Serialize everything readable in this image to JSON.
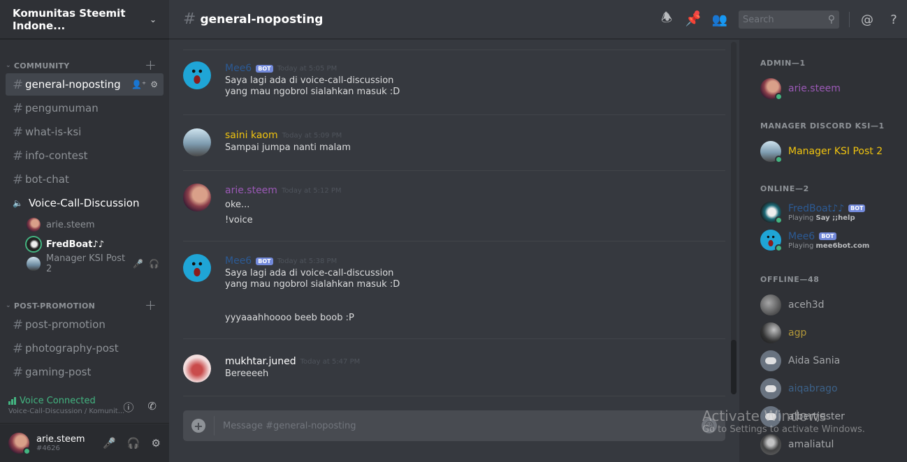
{
  "server": {
    "name": "Komunitas Steemit Indone...",
    "chevron_icon": "chevron-down-icon"
  },
  "categories": {
    "community": {
      "label": "COMMUNITY"
    },
    "post_promotion": {
      "label": "POST-PROMOTION"
    }
  },
  "channels": {
    "community": [
      {
        "name": "general-noposting",
        "active": true
      },
      {
        "name": "pengumuman"
      },
      {
        "name": "what-is-ksi"
      },
      {
        "name": "info-contest"
      },
      {
        "name": "bot-chat"
      }
    ],
    "voice": {
      "name": "Voice-Call-Discussion",
      "users": [
        {
          "name": "arie.steem"
        },
        {
          "name": "FredBoat♪♪",
          "speaking": true
        },
        {
          "name": "Manager KSI Post 2",
          "muted": true,
          "deafened": true
        }
      ]
    },
    "post_promotion": [
      {
        "name": "post-promotion"
      },
      {
        "name": "photography-post"
      },
      {
        "name": "gaming-post"
      }
    ]
  },
  "voice_panel": {
    "status": "Voice Connected",
    "location": "Voice-Call-Discussion / Komunit...",
    "status_color": "#43b581"
  },
  "user_panel": {
    "username": "arie.steem",
    "tag": "#4626"
  },
  "header": {
    "channel": "general-noposting",
    "search_placeholder": "Search"
  },
  "messages": [
    {
      "author": "Mee6",
      "bot": true,
      "bot_label": "BOT",
      "color": "#2c5a94",
      "timestamp": "Today at 5:05 PM",
      "lines": [
        "Saya lagi ada di voice-call-discussion",
        "yang mau ngobrol sialahkan masuk :D"
      ]
    },
    {
      "author": "saini kaom",
      "color": "#f1c40f",
      "timestamp": "Today at 5:09 PM",
      "lines": [
        "Sampai jumpa nanti malam"
      ]
    },
    {
      "author": "arie.steem",
      "color": "#9b59b6",
      "timestamp": "Today at 5:12 PM",
      "lines": [
        "oke...",
        "!voice"
      ]
    },
    {
      "author": "Mee6",
      "bot": true,
      "bot_label": "BOT",
      "color": "#2c5a94",
      "timestamp": "Today at 5:38 PM",
      "lines": [
        "Saya lagi ada di voice-call-discussion",
        "yang mau ngobrol sialahkan masuk :D"
      ],
      "extra": "yyyaaahhoooo beeb boob :P"
    },
    {
      "author": "mukhtar.juned",
      "color": "#ffffff",
      "timestamp": "Today at 5:47 PM",
      "lines": [
        "Bereeeeh"
      ]
    }
  ],
  "composer": {
    "placeholder": "Message #general-noposting"
  },
  "members": {
    "groups": [
      {
        "label": "ADMIN—1",
        "members": [
          {
            "name": "arie.steem",
            "color": "#9b59b6"
          }
        ]
      },
      {
        "label": "MANAGER DISCORD KSI—1",
        "members": [
          {
            "name": "Manager KSI Post 2",
            "color": "#f1c40f"
          }
        ]
      },
      {
        "label": "ONLINE—2",
        "members": [
          {
            "name": "FredBoat♪♪",
            "color": "#2c5a94",
            "bot": "BOT",
            "activity_prefix": "Playing ",
            "activity": "Say ;;help"
          },
          {
            "name": "Mee6",
            "color": "#2c5a94",
            "bot": "BOT",
            "activity_prefix": "Playing ",
            "activity": "mee6bot.com"
          }
        ]
      },
      {
        "label": "OFFLINE—48",
        "members": [
          {
            "name": "aceh3d",
            "color": "#b9bbbe"
          },
          {
            "name": "agp",
            "color": "#c9a93a"
          },
          {
            "name": "Aida Sania",
            "color": "#b9bbbe"
          },
          {
            "name": "aiqabrago",
            "color": "#3f6a97"
          },
          {
            "name": "albertjester",
            "color": "#b9bbbe"
          },
          {
            "name": "amaliatul",
            "color": "#b9bbbe"
          }
        ]
      }
    ]
  },
  "watermark": {
    "line1": "Activate Windows",
    "line2": "Go to Settings to activate Windows."
  }
}
